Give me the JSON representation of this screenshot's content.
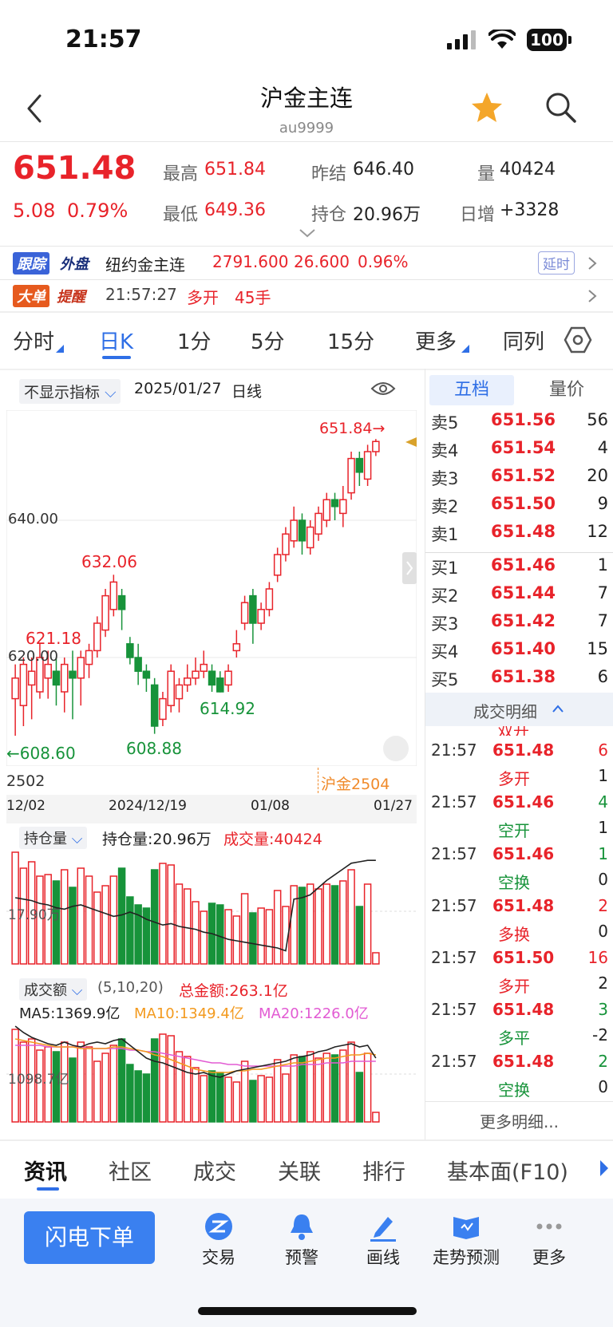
{
  "status": {
    "time": "21:57",
    "battery": "100"
  },
  "header": {
    "title": "沪金主连",
    "code": "au9999"
  },
  "quote": {
    "price": "651.48",
    "change": "5.08",
    "change_pct": "0.79%",
    "high_label": "最高",
    "high": "651.84",
    "low_label": "最低",
    "low": "649.36",
    "prev_label": "昨结",
    "prev": "646.40",
    "oi_label": "持仓",
    "oi": "20.96万",
    "vol_label": "量",
    "vol": "40424",
    "daily_label": "日增",
    "daily": "+3328"
  },
  "external": {
    "tag1": "跟踪",
    "tag2": "外盘",
    "name": "纽约金主连",
    "price": "2791.600",
    "change": "26.600",
    "pct": "0.96%",
    "badge": "延时"
  },
  "bigorder": {
    "tag1": "大单",
    "tag2": "提醒",
    "time": "21:57:27",
    "type": "多开",
    "qty": "45手"
  },
  "tabs": [
    "分时",
    "日K",
    "1分",
    "5分",
    "15分",
    "更多",
    "同列"
  ],
  "chart_header": {
    "indicator": "不显示指标",
    "date": "2025/01/27",
    "period": "日线"
  },
  "chart_labels": {
    "high_mark": "651.84→",
    "p640": "640.00",
    "p620": "620.00",
    "l632": "632.06",
    "l621": "621.18",
    "l614": "614.92",
    "l608a": "←608.60",
    "l608b": "608.88",
    "contract_left": "2502",
    "contract_right": "沪金2504",
    "dates": [
      "12/02",
      "2024/12/19",
      "01/08",
      "01/27"
    ]
  },
  "oi_panel": {
    "selector": "持仓量",
    "oi_text": "持仓量:20.96万",
    "vol_text": "成交量:40424",
    "axis": "17.90万"
  },
  "amt_panel": {
    "selector": "成交额",
    "params": "(5,10,20)",
    "total": "总金额:263.1亿",
    "ma5": "MA5:1369.9亿",
    "ma10": "MA10:1349.4亿",
    "ma20": "MA20:1226.0亿",
    "axis": "1098.7亿"
  },
  "orderbook": {
    "tab_active": "五档",
    "tab_other": "量价",
    "asks": [
      {
        "label": "卖5",
        "price": "651.56",
        "vol": "56"
      },
      {
        "label": "卖4",
        "price": "651.54",
        "vol": "4"
      },
      {
        "label": "卖3",
        "price": "651.52",
        "vol": "20"
      },
      {
        "label": "卖2",
        "price": "651.50",
        "vol": "9"
      },
      {
        "label": "卖1",
        "price": "651.48",
        "vol": "12"
      }
    ],
    "bids": [
      {
        "label": "买1",
        "price": "651.46",
        "vol": "1"
      },
      {
        "label": "买2",
        "price": "651.44",
        "vol": "7"
      },
      {
        "label": "买3",
        "price": "651.42",
        "vol": "7"
      },
      {
        "label": "买4",
        "price": "651.40",
        "vol": "15"
      },
      {
        "label": "买5",
        "price": "651.38",
        "vol": "6"
      }
    ],
    "detail_title": "成交明细",
    "trades": [
      {
        "time": "21:57",
        "price": "651.48",
        "qty": "6",
        "type": "多开",
        "oi": "1",
        "type_color": "red"
      },
      {
        "time": "21:57",
        "price": "651.46",
        "qty": "4",
        "type": "空开",
        "oi": "1",
        "type_color": "green"
      },
      {
        "time": "21:57",
        "price": "651.46",
        "qty": "1",
        "type": "空换",
        "oi": "0",
        "type_color": "green"
      },
      {
        "time": "21:57",
        "price": "651.48",
        "qty": "2",
        "type": "多换",
        "oi": "0",
        "type_color": "red"
      },
      {
        "time": "21:57",
        "price": "651.50",
        "qty": "16",
        "type": "多开",
        "oi": "2",
        "type_color": "red"
      },
      {
        "time": "21:57",
        "price": "651.48",
        "qty": "3",
        "type": "多平",
        "oi": "-2",
        "type_color": "green"
      },
      {
        "time": "21:57",
        "price": "651.48",
        "qty": "2",
        "type": "空换",
        "oi": "0",
        "type_color": "green"
      }
    ],
    "top_partial": "双开",
    "more": "更多明细..."
  },
  "bottom_tabs": [
    "资讯",
    "社区",
    "成交",
    "关联",
    "排行",
    "基本面(F10)"
  ],
  "actions": {
    "flash": "闪电下单",
    "items": [
      "交易",
      "预警",
      "画线",
      "走势预测",
      "更多"
    ]
  },
  "colors": {
    "up": "#e8232a",
    "down": "#17933a",
    "accent": "#2f6fe6",
    "ma5": "#222222",
    "ma10": "#f39a1e",
    "ma20": "#e25bd3"
  }
}
